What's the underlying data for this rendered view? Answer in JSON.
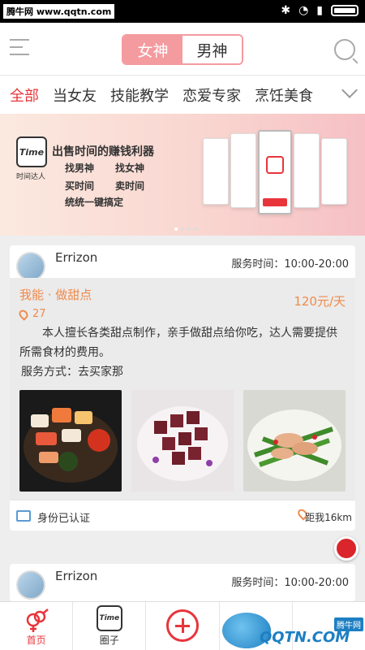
{
  "statusbar": {
    "watermark": "腾牛网 www.qqtn.com"
  },
  "header": {
    "toggle": [
      "女神",
      "男神"
    ]
  },
  "categories": [
    "全部",
    "当女友",
    "技能教学",
    "恋爱专家",
    "烹饪美食"
  ],
  "banner": {
    "logo": "Time",
    "brand": "时间达人",
    "title": "出售时间的赚钱利器",
    "lines": [
      "找男神",
      "找女神",
      "买时间",
      "卖时间",
      "统统一键搞定"
    ]
  },
  "cards": [
    {
      "name": "Errizon",
      "service_time": "服务时间：10:00-20:00",
      "skill": "我能 · 做甜点",
      "price": "120元/天",
      "likes": "27",
      "desc": "本人擅长各类甜点制作，亲手做甜点给你吃，达人需要提供所需食材的费用。",
      "mode": "服务方式：去买家那",
      "verified": "身份已认证",
      "distance": "距我16km"
    },
    {
      "name": "Errizon",
      "service_time": "服务时间：10:00-20:00"
    }
  ],
  "tabbar": {
    "home": "首页",
    "circle": "圈子",
    "circle_icon": "Time"
  },
  "colors": {
    "accent": "#e8353b",
    "pink": "#f49ba0",
    "orange": "#f08a4b"
  },
  "watermark_br": {
    "text": "QQTN.COM",
    "tag": "腾牛网"
  }
}
